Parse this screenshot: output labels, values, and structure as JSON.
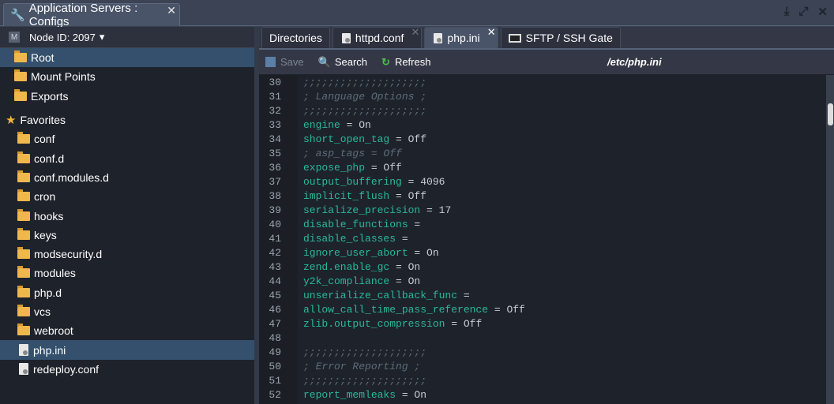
{
  "window": {
    "title": "Application Servers : Configs",
    "close": "✕",
    "icons": [
      "download-icon",
      "expand-icon",
      "close-icon"
    ]
  },
  "left": {
    "node_badge": "M",
    "node_label": "Node ID: 2097",
    "caret": "▾",
    "top_items": [
      {
        "label": "Root",
        "selected": true
      },
      {
        "label": "Mount Points"
      },
      {
        "label": "Exports"
      }
    ],
    "favorites_label": "Favorites",
    "favorites": [
      {
        "label": "conf",
        "type": "folder"
      },
      {
        "label": "conf.d",
        "type": "folder"
      },
      {
        "label": "conf.modules.d",
        "type": "folder"
      },
      {
        "label": "cron",
        "type": "folder"
      },
      {
        "label": "hooks",
        "type": "folder"
      },
      {
        "label": "keys",
        "type": "folder"
      },
      {
        "label": "modsecurity.d",
        "type": "folder"
      },
      {
        "label": "modules",
        "type": "folder"
      },
      {
        "label": "php.d",
        "type": "folder"
      },
      {
        "label": "vcs",
        "type": "folder"
      },
      {
        "label": "webroot",
        "type": "folder"
      },
      {
        "label": "php.ini",
        "type": "file",
        "selected": true
      },
      {
        "label": "redeploy.conf",
        "type": "file"
      }
    ]
  },
  "tabs": [
    {
      "label": "Directories"
    },
    {
      "label": "httpd.conf",
      "close": "✕"
    },
    {
      "label": "php.ini",
      "close": "✕",
      "active": true
    },
    {
      "label": "SFTP / SSH Gate"
    }
  ],
  "toolbar": {
    "save": "Save",
    "search": "Search",
    "refresh": "Refresh",
    "path": "/etc/php.ini"
  },
  "code": [
    {
      "n": "30",
      "c": ";;;;;;;;;;;;;;;;;;;;"
    },
    {
      "n": "31",
      "c": "; Language Options ;"
    },
    {
      "n": "32",
      "c": ";;;;;;;;;;;;;;;;;;;;"
    },
    {
      "n": "33",
      "k": "engine",
      "v": " = On"
    },
    {
      "n": "34",
      "k": "short_open_tag",
      "v": " = Off"
    },
    {
      "n": "35",
      "c": "; asp_tags = Off"
    },
    {
      "n": "36",
      "k": "expose_php",
      "v": " = Off"
    },
    {
      "n": "37",
      "k": "output_buffering",
      "v": " = 4096"
    },
    {
      "n": "38",
      "k": "implicit_flush",
      "v": " = Off"
    },
    {
      "n": "39",
      "k": "serialize_precision",
      "v": " = 17"
    },
    {
      "n": "40",
      "k": "disable_functions",
      "v": " ="
    },
    {
      "n": "41",
      "k": "disable_classes",
      "v": " ="
    },
    {
      "n": "42",
      "k": "ignore_user_abort",
      "v": " = On"
    },
    {
      "n": "43",
      "k": "zend.enable_gc",
      "v": " = On"
    },
    {
      "n": "44",
      "k": "y2k_compliance",
      "v": " = On"
    },
    {
      "n": "45",
      "k": "unserialize_callback_func",
      "v": " ="
    },
    {
      "n": "46",
      "k": "allow_call_time_pass_reference",
      "v": " = Off"
    },
    {
      "n": "47",
      "k": "zlib.output_compression",
      "v": " = Off"
    },
    {
      "n": "48"
    },
    {
      "n": "49",
      "c": ";;;;;;;;;;;;;;;;;;;;"
    },
    {
      "n": "50",
      "c": "; Error Reporting ;"
    },
    {
      "n": "51",
      "c": ";;;;;;;;;;;;;;;;;;;;"
    },
    {
      "n": "52",
      "k": "report_memleaks",
      "v": " = On"
    }
  ]
}
